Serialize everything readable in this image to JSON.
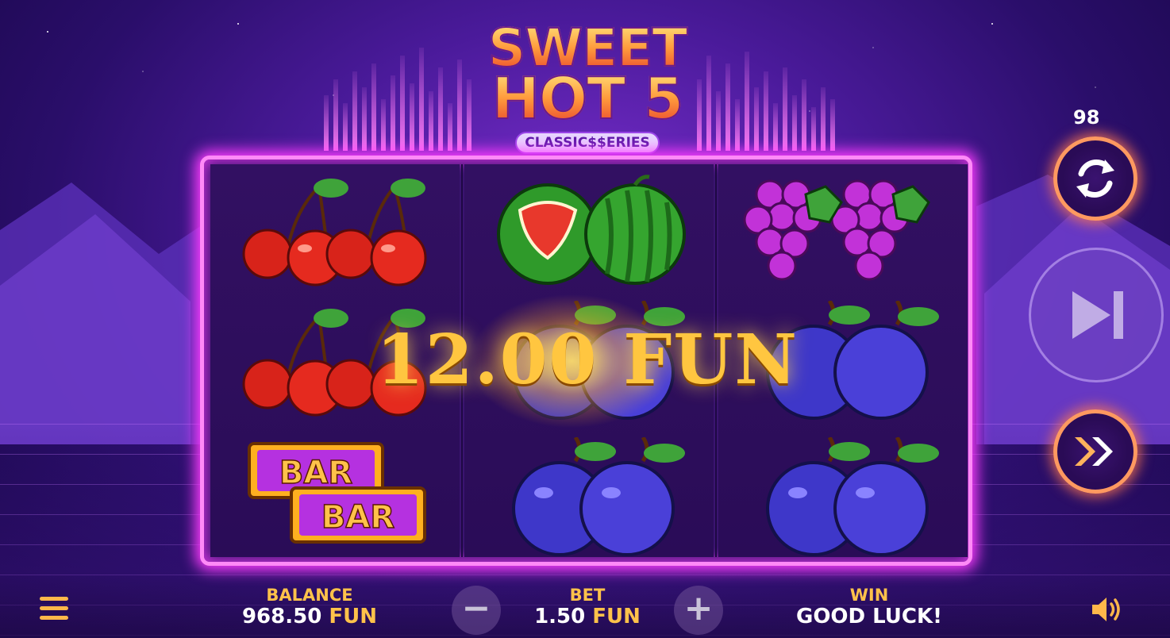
{
  "game": {
    "logo_line1": "SWEET",
    "logo_line2": "HOT 5",
    "logo_series": "CLASSIC$$ERIES"
  },
  "reels": [
    [
      "cherry",
      "cherry",
      "bar-bar"
    ],
    [
      "watermelon",
      "plum",
      "plum"
    ],
    [
      "grapes",
      "plum",
      "plum"
    ]
  ],
  "win_display": {
    "amount": "12.00 FUN"
  },
  "controls": {
    "spin_counter": "98",
    "autoplay_icon": "autoplay-refresh-icon",
    "skip_icon": "skip-forward-icon",
    "turbo_icon": "fast-forward-icon"
  },
  "bottom": {
    "balance_label": "BALANCE",
    "balance_value": "968.50",
    "balance_currency": "FUN",
    "bet_label": "BET",
    "bet_value": "1.50",
    "bet_currency": "FUN",
    "win_label": "WIN",
    "win_value": "GOOD LUCK!",
    "minus_label": "−",
    "plus_label": "+"
  },
  "colors": {
    "accent_gold": "#ffc24a",
    "frame_pink": "#ff8af7",
    "button_orange": "#ff9960"
  }
}
